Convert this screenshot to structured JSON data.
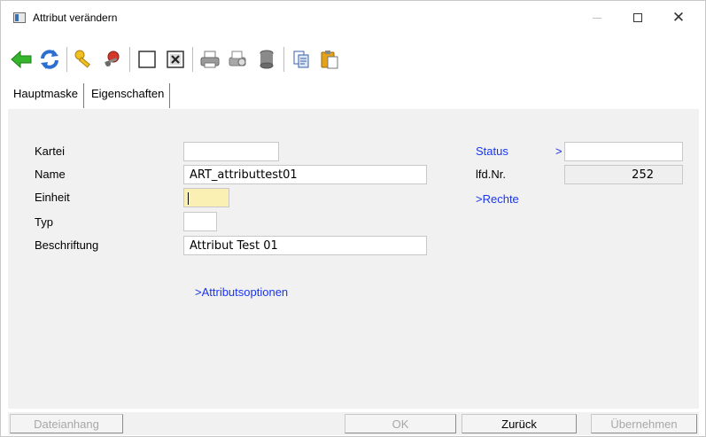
{
  "window": {
    "title": "Attribut verändern"
  },
  "tabs": [
    {
      "label": "Hauptmaske"
    },
    {
      "label": "Eigenschaften"
    }
  ],
  "form": {
    "kartei": {
      "label": "Kartei",
      "value": ""
    },
    "name": {
      "label": "Name",
      "value": "ART_attributtest01"
    },
    "einheit": {
      "label": "Einheit",
      "value": ""
    },
    "typ": {
      "label": "Typ",
      "value": ""
    },
    "beschriftung": {
      "label": "Beschriftung",
      "value": "Attribut Test 01"
    },
    "status": {
      "label": "Status",
      "arrow": ">",
      "value": ""
    },
    "lfdnr": {
      "label": "lfd.Nr.",
      "value": "252"
    },
    "rechte_link": ">Rechte",
    "attributsoptionen_link": ">Attributsoptionen"
  },
  "buttons": {
    "dateianhang": "Dateianhang",
    "ok": "OK",
    "zurueck": "Zurück",
    "uebernehmen": "Übernehmen"
  },
  "toolbar_icons": [
    "back-arrow-icon",
    "refresh-icon",
    "key-icon",
    "keyring-icon",
    "empty-box-icon",
    "delete-box-icon",
    "printer-icon",
    "print-preview-icon",
    "database-icon",
    "copy-icon",
    "paste-icon"
  ],
  "colors": {
    "link": "#1a35f0",
    "panel": "#f1f1f1",
    "highlight_field": "#fbf0b4"
  }
}
